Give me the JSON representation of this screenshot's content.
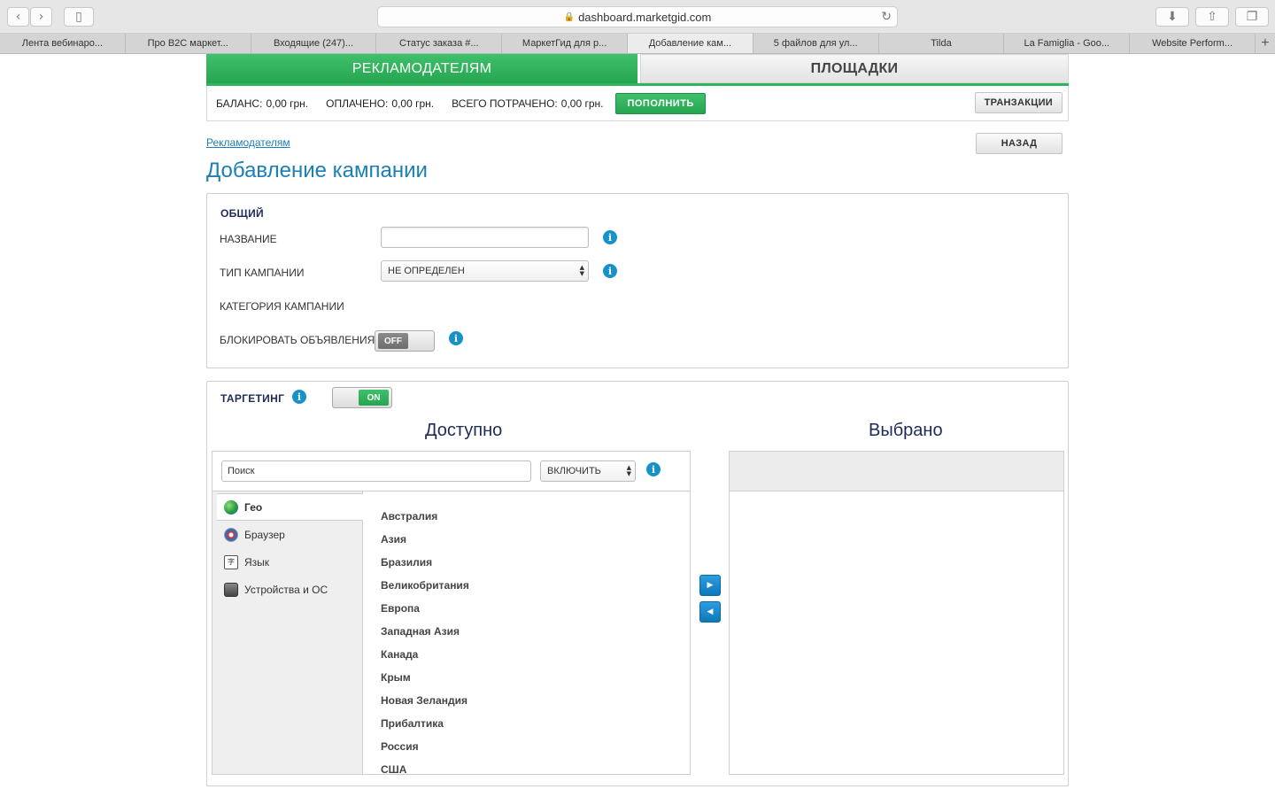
{
  "browser": {
    "url": "dashboard.marketgid.com",
    "tabs": [
      {
        "label": "Лента вебинаро...",
        "active": false
      },
      {
        "label": "Про B2C маркет...",
        "active": false
      },
      {
        "label": "Входящие (247)...",
        "active": false
      },
      {
        "label": "Статус заказа #...",
        "active": false
      },
      {
        "label": "МаркетГид для р...",
        "active": false
      },
      {
        "label": "Добавление кам...",
        "active": true
      },
      {
        "label": "5 файлов для ул...",
        "active": false
      },
      {
        "label": "Tilda",
        "active": false
      },
      {
        "label": "La Famiglia - Goo...",
        "active": false
      },
      {
        "label": "Website Perform...",
        "active": false
      }
    ]
  },
  "top_tabs": {
    "advertisers": "РЕКЛАМОДАТЕЛЯМ",
    "sites": "ПЛОЩАДКИ"
  },
  "balance": {
    "balance_label": "Баланс:",
    "balance_value": "0,00 грн.",
    "paid_label": "Оплачено:",
    "paid_value": "0,00 грн.",
    "spent_label": "Всего потрачено:",
    "spent_value": "0,00 грн.",
    "topup_button": "ПОПОЛНИТЬ",
    "transactions_button": "ТРАНЗАКЦИИ"
  },
  "breadcrumb": "Рекламодателям",
  "back_button": "НАЗАД",
  "page_title": "Добавление кампании",
  "general": {
    "title": "Общий",
    "name_label": "Название",
    "name_value": "",
    "type_label": "Тип кампании",
    "type_value": "НЕ ОПРЕДЕЛЕН",
    "category_label": "Категория кампании",
    "block_label": "Блокировать объявления",
    "block_toggle": "OFF"
  },
  "targeting": {
    "title": "Таргетинг",
    "toggle": "ON",
    "available_title": "Доступно",
    "selected_title": "Выбрано",
    "search_placeholder": "Поиск",
    "mode_value": "ВКЛЮЧИТЬ",
    "categories": [
      {
        "label": "Гео",
        "icon": "globe-icon",
        "active": true
      },
      {
        "label": "Браузер",
        "icon": "browser-icon",
        "active": false
      },
      {
        "label": "Язык",
        "icon": "language-icon",
        "active": false
      },
      {
        "label": "Устройства и ОС",
        "icon": "device-icon",
        "active": false
      }
    ],
    "items": [
      "Австралия",
      "Азия",
      "Бразилия",
      "Великобритания",
      "Европа",
      "Западная Азия",
      "Канада",
      "Крым",
      "Новая Зеландия",
      "Прибалтика",
      "Россия",
      "США"
    ]
  },
  "colors": {
    "accent_green": "#2eb45b",
    "link_blue": "#1b7fb6",
    "info_blue": "#1792c8"
  }
}
